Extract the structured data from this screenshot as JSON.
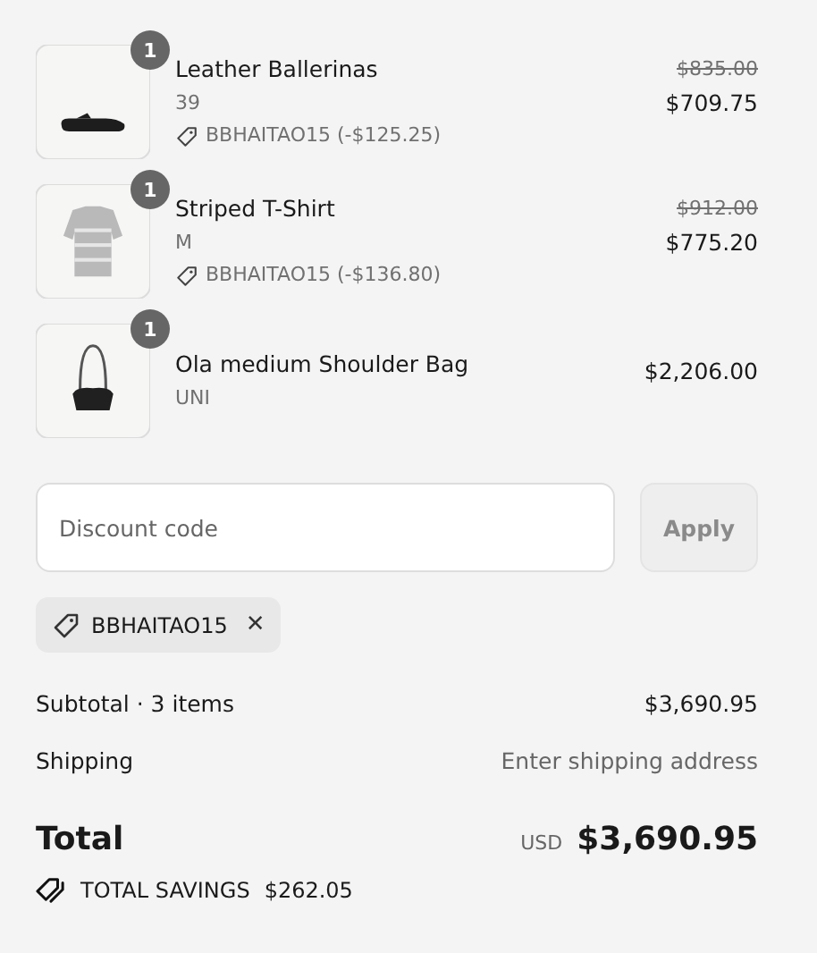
{
  "items": [
    {
      "kind": "shoe",
      "quantity": "1",
      "name": "Leather Ballerinas",
      "variant": "39",
      "discount": "BBHAITAO15 (-$125.25)",
      "original_price": "$835.00",
      "price": "$709.75"
    },
    {
      "kind": "shirt",
      "quantity": "1",
      "name": "Striped T-Shirt",
      "variant": "M",
      "discount": "BBHAITAO15 (-$136.80)",
      "original_price": "$912.00",
      "price": "$775.20"
    },
    {
      "kind": "bag",
      "quantity": "1",
      "name": "Ola medium Shoulder Bag",
      "variant": "UNI",
      "price": "$2,206.00"
    }
  ],
  "discount_field": {
    "placeholder": "Discount code"
  },
  "apply_button": {
    "label": "Apply",
    "disabled": true
  },
  "applied_codes": [
    {
      "code": "BBHAITAO15",
      "remove": "✕"
    }
  ],
  "summary": [
    {
      "label": "Subtotal · 3 items",
      "value": "$3,690.95",
      "kind": "amount"
    },
    {
      "label": "Shipping",
      "value": "Enter shipping address",
      "kind": "note"
    }
  ],
  "total": {
    "label": "Total",
    "currency": "USD",
    "amount": "$3,690.95"
  },
  "savings": {
    "label": "TOTAL SAVINGS",
    "amount": "$262.05"
  }
}
